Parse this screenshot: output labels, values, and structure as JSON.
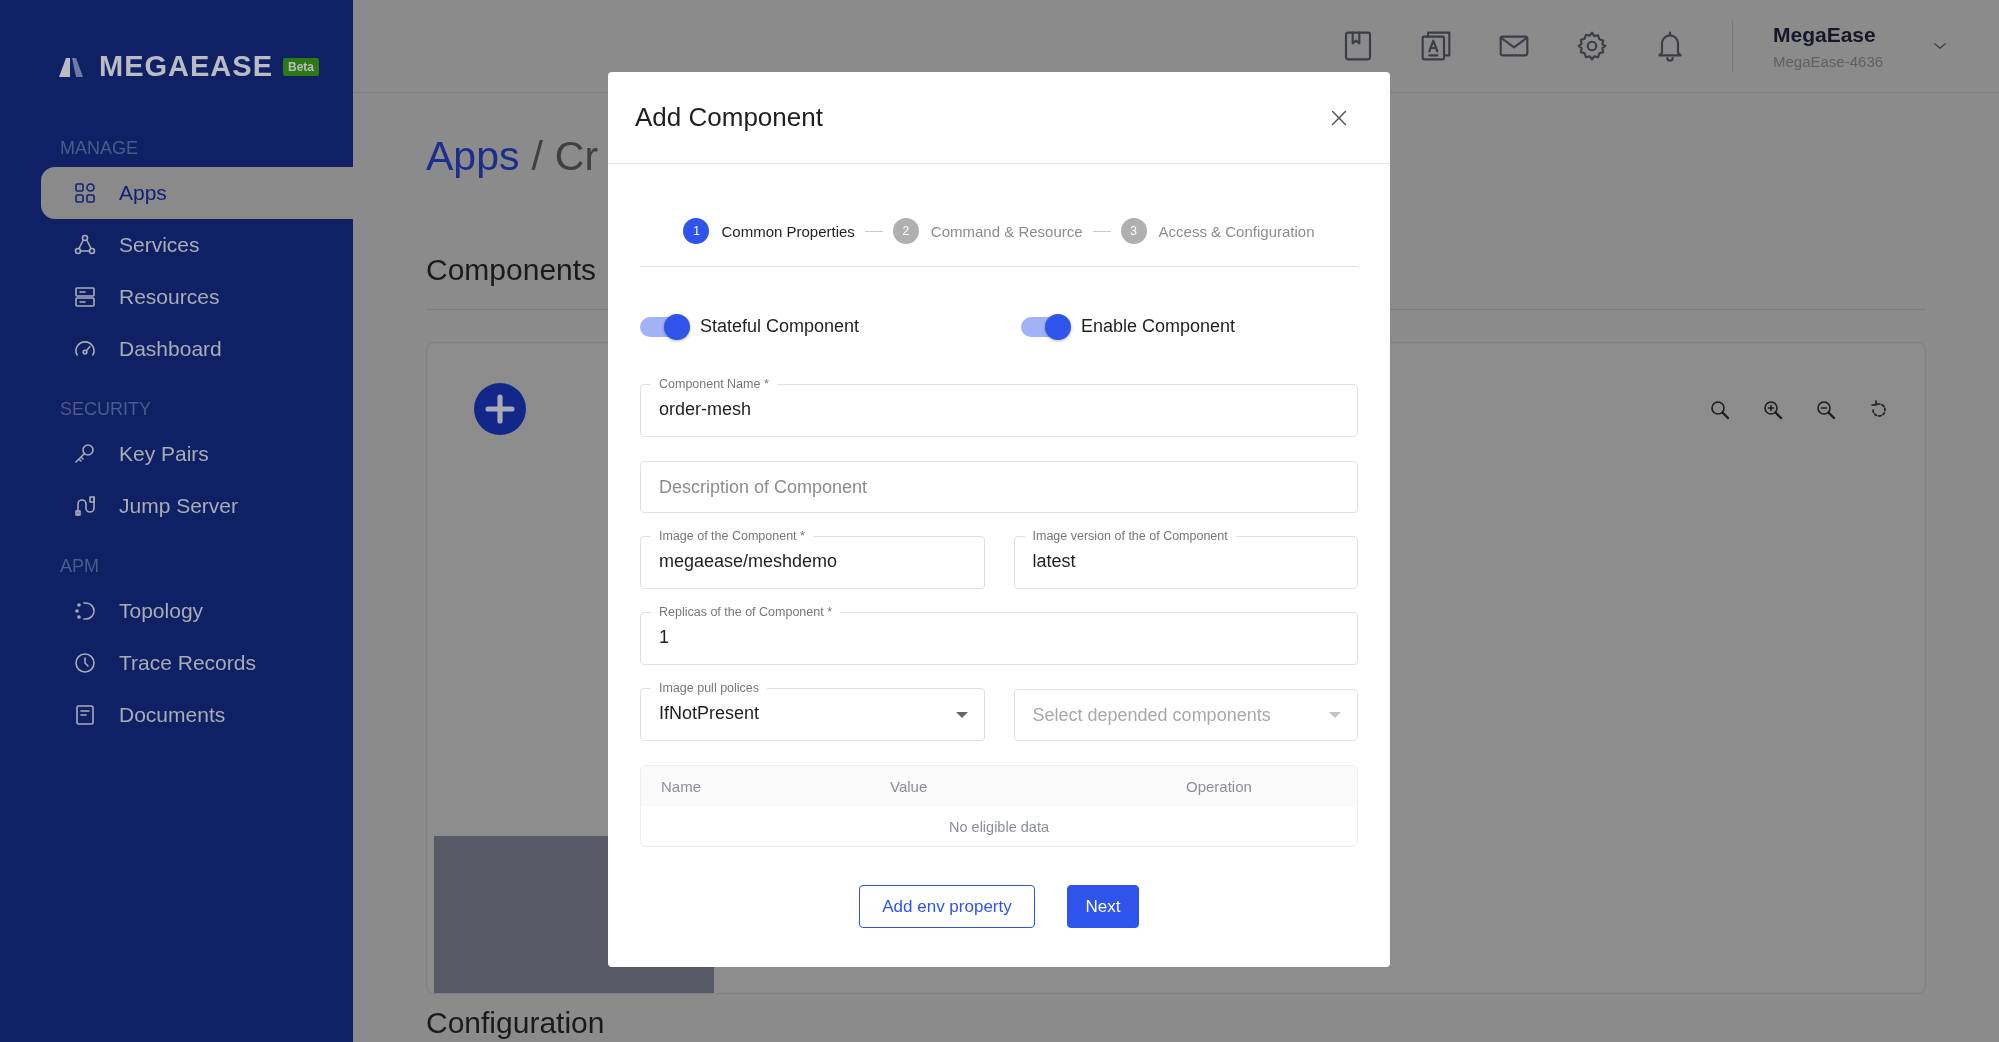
{
  "sidebar": {
    "logo": "MEGAEASE",
    "badge": "Beta",
    "sections": [
      {
        "title": "MANAGE",
        "items": [
          {
            "label": "Apps",
            "selected": true
          },
          {
            "label": "Services",
            "selected": false
          },
          {
            "label": "Resources",
            "selected": false
          },
          {
            "label": "Dashboard",
            "selected": false
          }
        ]
      },
      {
        "title": "SECURITY",
        "items": [
          {
            "label": "Key Pairs",
            "selected": false
          },
          {
            "label": "Jump Server",
            "selected": false
          }
        ]
      },
      {
        "title": "APM",
        "items": [
          {
            "label": "Topology",
            "selected": false
          },
          {
            "label": "Trace Records",
            "selected": false
          },
          {
            "label": "Documents",
            "selected": false
          }
        ]
      }
    ]
  },
  "header": {
    "user_name": "MegaEase",
    "user_id": "MegaEase-4636"
  },
  "page": {
    "breadcrumb": [
      "Apps",
      "Cr"
    ],
    "breadcrumb_separator": "/",
    "components_title": "Components",
    "configuration_title": "Configuration"
  },
  "modal": {
    "title": "Add Component",
    "steps": [
      {
        "number": "1",
        "label": "Common Properties",
        "selected": true
      },
      {
        "number": "2",
        "label": "Command & Resource",
        "selected": false
      },
      {
        "number": "3",
        "label": "Access & Configuration",
        "selected": false
      }
    ],
    "toggles": [
      {
        "label": "Stateful Component",
        "on": true
      },
      {
        "label": "Enable Component",
        "on": true
      }
    ],
    "field_rows": [
      [
        {
          "kind": "text",
          "label": "Component Name *",
          "value": "order-mesh"
        }
      ],
      [
        {
          "kind": "text",
          "placeholder": "Description of Component"
        }
      ],
      [
        {
          "kind": "text",
          "label": "Image of the Component *",
          "value": "megaease/meshdemo"
        },
        {
          "kind": "text",
          "label": "Image version of the of Component",
          "value": "latest"
        }
      ],
      [
        {
          "kind": "text",
          "label": "Replicas of the of Component *",
          "value": "1"
        }
      ],
      [
        {
          "kind": "select",
          "label": "Image pull polices",
          "value": "IfNotPresent"
        },
        {
          "kind": "select",
          "placeholder": "Select depended components"
        }
      ]
    ],
    "env_table": {
      "columns": [
        "Name",
        "Value",
        "Operation"
      ],
      "empty_text": "No eligible data"
    },
    "buttons": [
      {
        "label": "Add env property",
        "kind": "secondary"
      },
      {
        "label": "Next",
        "kind": "primary"
      }
    ]
  }
}
